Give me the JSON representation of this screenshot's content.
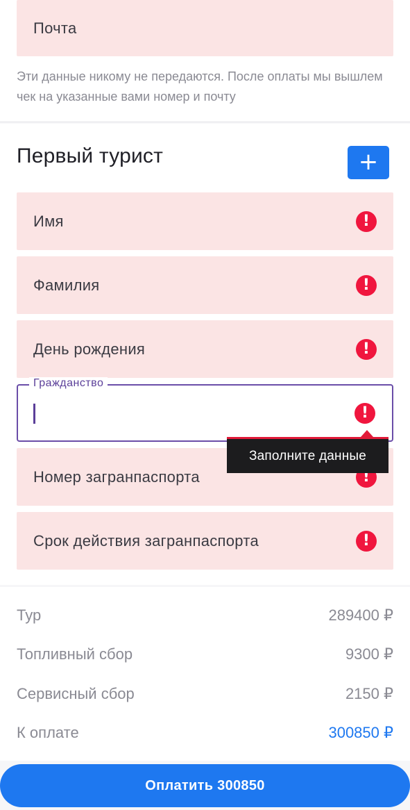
{
  "contact": {
    "email_label": "Почта",
    "note": "Эти данные никому не передаются. После оплаты мы вышлем чек на указанные вами номер и почту"
  },
  "tourist": {
    "title": "Первый турист",
    "add_label": "+",
    "fields": {
      "first_name": "Имя",
      "last_name": "Фамилия",
      "birthday": "День рождения",
      "citizenship": "Гражданство",
      "passport_number": "Номер загранпаспорта",
      "passport_expiry": "Срок действия загранпаспорта"
    },
    "error_glyph": "!",
    "tooltip": "Заполните данные"
  },
  "totals": {
    "tour_label": "Тур",
    "tour_value": "289400 ₽",
    "fuel_label": "Топливный сбор",
    "fuel_value": "9300 ₽",
    "service_label": "Сервисный сбор",
    "service_value": "2150 ₽",
    "due_label": "К оплате",
    "due_value": "300850 ₽"
  },
  "pay_button": "Оплатить 300850",
  "colors": {
    "accent": "#1e78f0",
    "error_field_bg": "#fbe4e4",
    "error_icon": "#f0163e",
    "focus": "#6a4da8"
  },
  "icons": {
    "error": "exclamation-circle-icon",
    "add": "plus-icon"
  }
}
